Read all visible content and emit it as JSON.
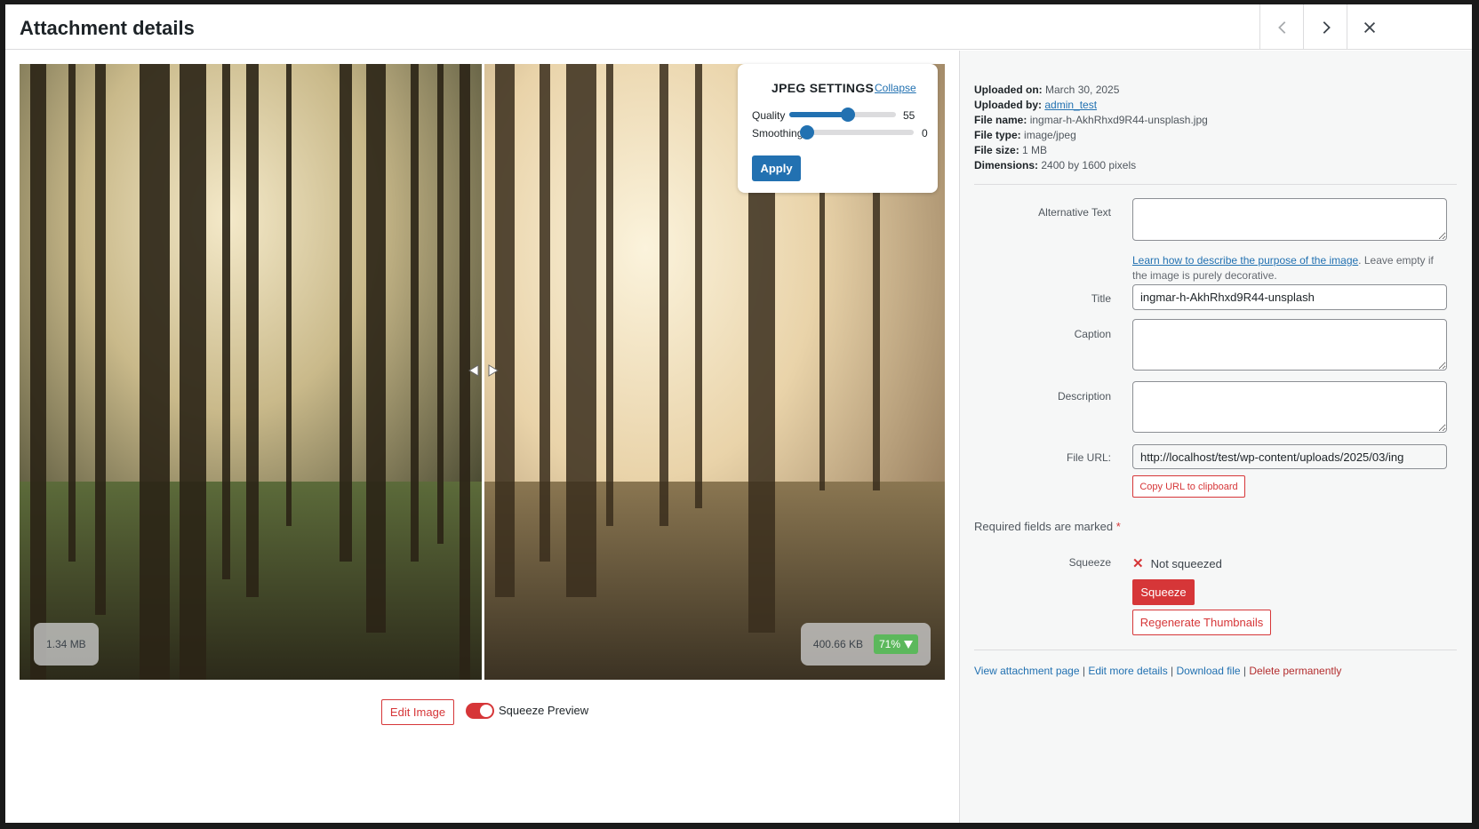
{
  "modal": {
    "title": "Attachment details"
  },
  "header_buttons": {
    "previous_icon": "chevron-left-icon",
    "next_icon": "chevron-right-icon",
    "close_icon": "close-icon"
  },
  "preview": {
    "original_size": "1.34 MB",
    "squeezed_size": "400.66 KB",
    "savings_percent": "71%",
    "savings_icon": "arrow-down-icon"
  },
  "jpeg_settings": {
    "title": "JPEG SETTINGS",
    "collapse_label": "Collapse",
    "quality_label": "Quality",
    "quality_value": "55",
    "quality_fraction": 0.55,
    "smoothing_label": "Smoothing",
    "smoothing_value": "0",
    "smoothing_fraction": 0,
    "apply_label": "Apply"
  },
  "actions": {
    "edit_image_label": "Edit Image",
    "squeeze_preview_label": "Squeeze Preview",
    "squeeze_preview_on": true
  },
  "details": {
    "uploaded_on_label": "Uploaded on:",
    "uploaded_on": "March 30, 2025",
    "uploaded_by_label": "Uploaded by:",
    "uploaded_by": "admin_test",
    "file_name_label": "File name:",
    "file_name": "ingmar-h-AkhRhxd9R44-unsplash.jpg",
    "file_type_label": "File type:",
    "file_type": "image/jpeg",
    "file_size_label": "File size:",
    "file_size": "1 MB",
    "dimensions_label": "Dimensions:",
    "dimensions": "2400 by 1600 pixels"
  },
  "form": {
    "alt_text_label": "Alternative Text",
    "alt_text_value": "",
    "alt_help_link": "Learn how to describe the purpose of the image",
    "alt_help_text": ". Leave empty if the image is purely decorative.",
    "title_label": "Title",
    "title_value": "ingmar-h-AkhRhxd9R44-unsplash",
    "caption_label": "Caption",
    "caption_value": "",
    "description_label": "Description",
    "description_value": "",
    "file_url_label": "File URL:",
    "file_url_value": "http://localhost/test/wp-content/uploads/2025/03/ing",
    "copy_url_label": "Copy URL to clipboard",
    "required_text": "Required fields are marked",
    "required_star": "*"
  },
  "squeeze": {
    "label": "Squeeze",
    "status": "Not squeezed",
    "button_label": "Squeeze",
    "regenerate_label": "Regenerate Thumbnails"
  },
  "footer_links": {
    "view_attachment": "View attachment page",
    "edit_more": "Edit more details",
    "download": "Download file",
    "delete": "Delete permanently",
    "separator": " | "
  }
}
